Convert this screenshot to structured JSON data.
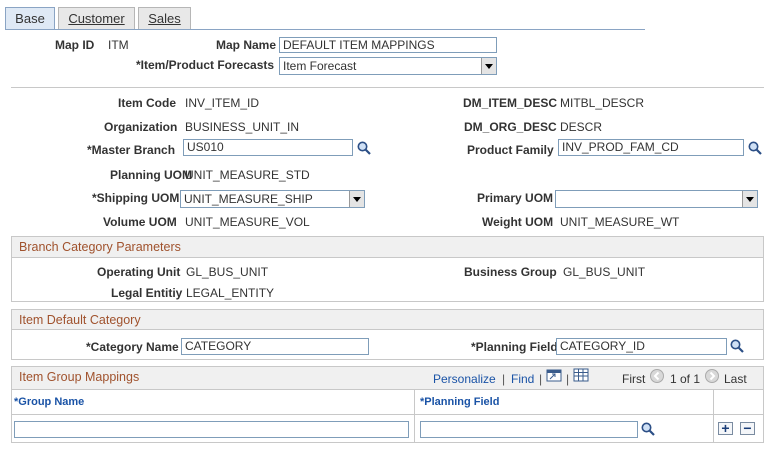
{
  "tabs": [
    {
      "label": "Base",
      "active": true
    },
    {
      "label": "Customer",
      "active": false
    },
    {
      "label": "Sales",
      "active": false
    }
  ],
  "header": {
    "map_id_label": "Map ID",
    "map_id_value": "ITM",
    "map_name_label": "Map Name",
    "map_name_value": "DEFAULT ITEM MAPPINGS",
    "forecast_label": "*Item/Product Forecasts",
    "forecast_value": "Item Forecast"
  },
  "fields": {
    "item_code_label": "Item Code",
    "item_code_value": "INV_ITEM_ID",
    "dm_item_desc_label": "DM_ITEM_DESC",
    "dm_item_desc_value": "MITBL_DESCR",
    "organization_label": "Organization",
    "organization_value": "BUSINESS_UNIT_IN",
    "dm_org_desc_label": "DM_ORG_DESC",
    "dm_org_desc_value": "DESCR",
    "master_branch_label": "*Master Branch",
    "master_branch_value": "US010",
    "product_family_label": "Product Family",
    "product_family_value": "INV_PROD_FAM_CD",
    "planning_uom_label": "Planning UOM",
    "planning_uom_value": "UNIT_MEASURE_STD",
    "shipping_uom_label": "*Shipping UOM",
    "shipping_uom_value": "UNIT_MEASURE_SHIP",
    "primary_uom_label": "Primary UOM",
    "primary_uom_value": "",
    "volume_uom_label": "Volume UOM",
    "volume_uom_value": "UNIT_MEASURE_VOL",
    "weight_uom_label": "Weight UOM",
    "weight_uom_value": "UNIT_MEASURE_WT"
  },
  "branch_category": {
    "title": "Branch Category Parameters",
    "operating_unit_label": "Operating Unit",
    "operating_unit_value": "GL_BUS_UNIT",
    "business_group_label": "Business Group",
    "business_group_value": "GL_BUS_UNIT",
    "legal_entity_label": "Legal Entitiy",
    "legal_entity_value": "LEGAL_ENTITY"
  },
  "item_default_category": {
    "title": "Item Default Category",
    "category_name_label": "*Category Name",
    "category_name_value": "CATEGORY",
    "planning_field_label": "*Planning Field",
    "planning_field_value": "CATEGORY_ID"
  },
  "item_group_mappings": {
    "title": "Item Group Mappings",
    "personalize": "Personalize",
    "separator": "|",
    "find": "Find",
    "first": "First",
    "range": "1 of 1",
    "last": "Last",
    "columns": [
      "*Group Name",
      "*Planning Field"
    ],
    "rows": [
      {
        "group_name": "",
        "planning_field": ""
      }
    ],
    "add": "+",
    "remove": "−"
  },
  "colors": {
    "accent_link": "#1a53a6",
    "section_title": "#a0522d",
    "tab_active": "#dfe9f5"
  },
  "icons": [
    "lookup-icon",
    "view-all-icon",
    "download-icon",
    "prev-arrow-icon",
    "next-arrow-icon",
    "dropdown-arrow-icon"
  ]
}
